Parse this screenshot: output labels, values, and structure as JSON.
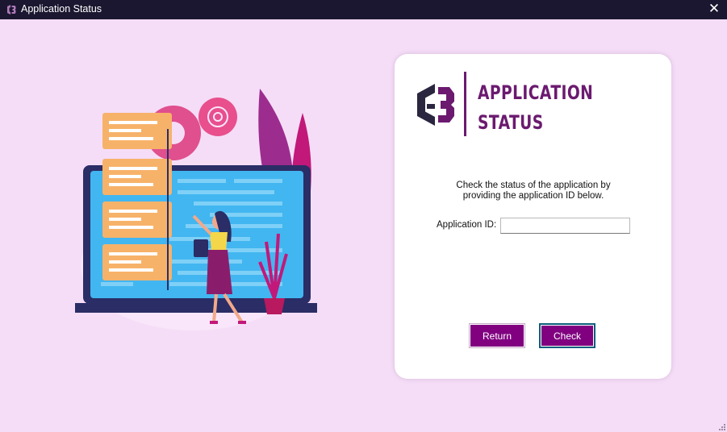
{
  "window": {
    "title": "Application Status",
    "close_glyph": "✕",
    "icon": "app-logo-icon"
  },
  "brand": {
    "title_line1": "APPLICATION",
    "title_line2": "STATUS",
    "logo": "g3-logo",
    "color": "#6b1a6f"
  },
  "form": {
    "instruction_line1": "Check the status of the application by",
    "instruction_line2": "providing the application ID below.",
    "app_id_label": "Application ID:",
    "app_id_value": "",
    "app_id_placeholder": ""
  },
  "buttons": {
    "return_label": "Return",
    "check_label": "Check",
    "color": "#800080"
  },
  "colors": {
    "background": "#f5ddf7",
    "titlebar": "#1b1730",
    "card": "#ffffff"
  }
}
